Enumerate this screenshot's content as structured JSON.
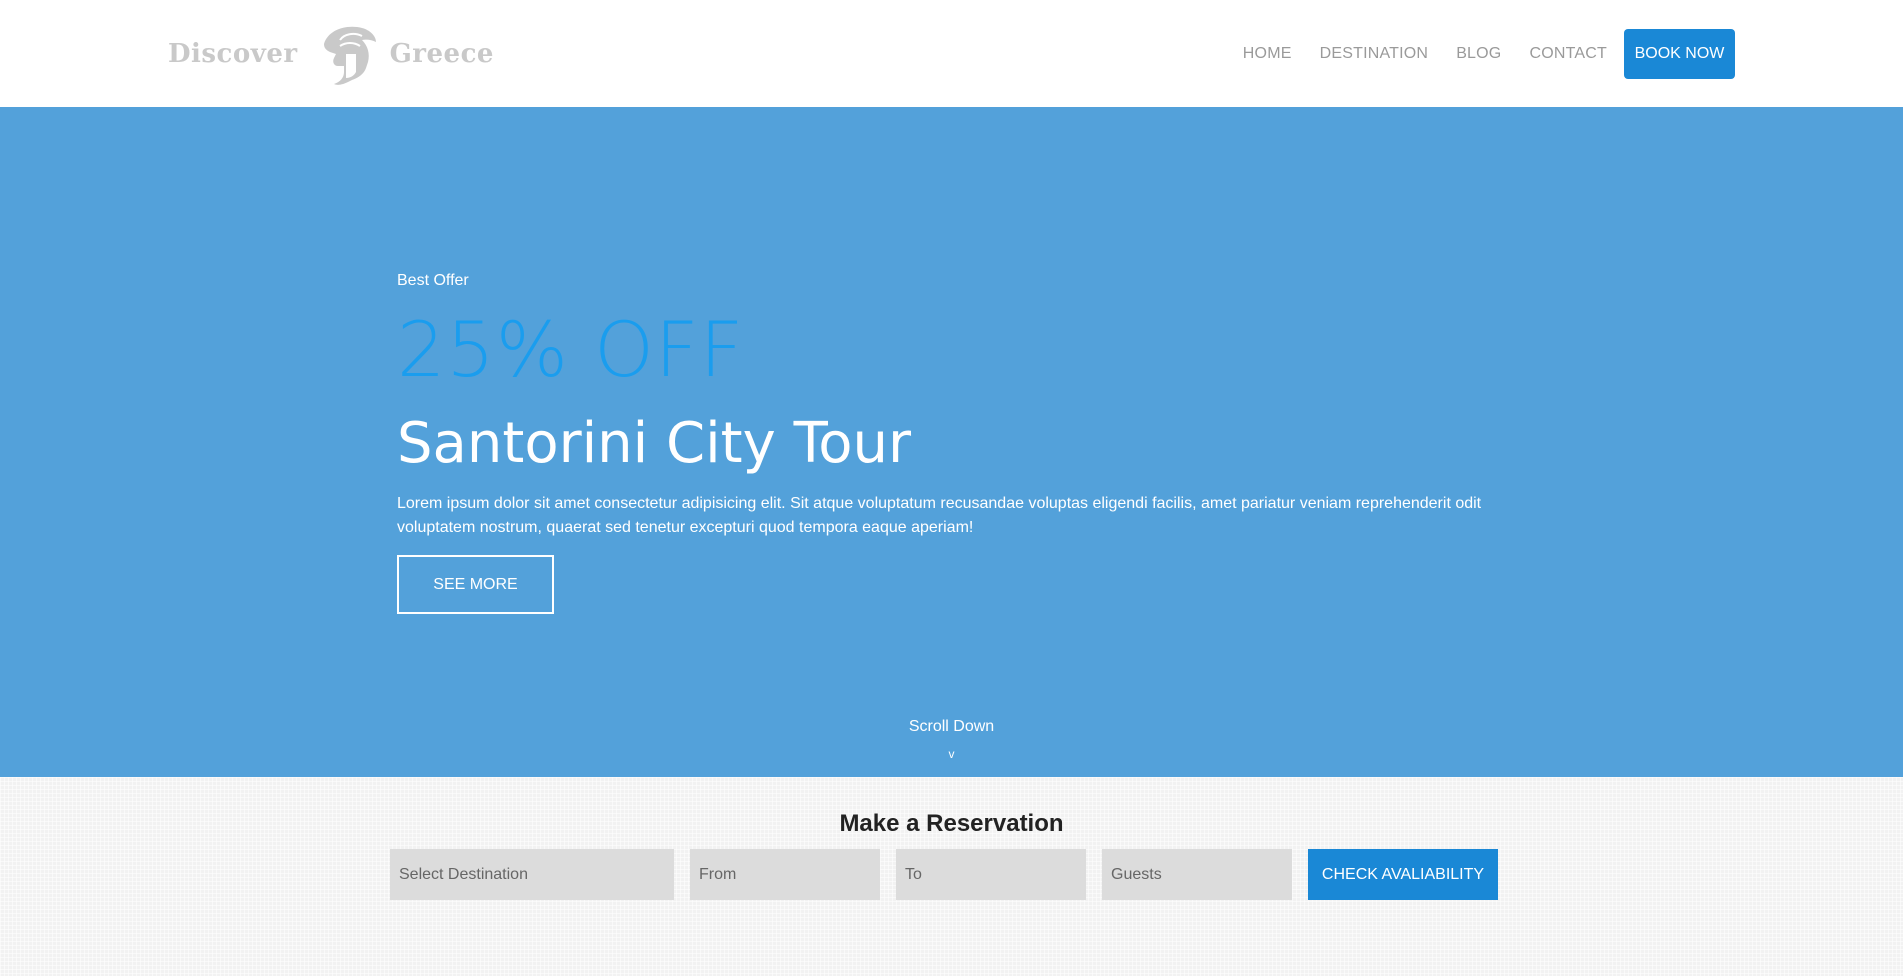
{
  "header": {
    "logo": {
      "word_left": "Discover",
      "word_right": "Greece",
      "icon": "spartan-helmet-icon"
    },
    "nav": {
      "items": [
        {
          "label": "HOME"
        },
        {
          "label": "DESTINATION"
        },
        {
          "label": "BLOG"
        },
        {
          "label": "CONTACT"
        }
      ],
      "book_label": "BOOK NOW"
    }
  },
  "hero": {
    "eyebrow": "Best Offer",
    "discount": "25% OFF",
    "title": "Santorini City Tour",
    "description": "Lorem ipsum dolor sit amet consectetur adipisicing elit. Sit atque voluptatum recusandae voluptas eligendi facilis, amet pariatur veniam reprehenderit odit voluptatem nostrum, quaerat sed tenetur excepturi quod tempora eaque aperiam!",
    "cta_label": "SEE MORE",
    "scroll_label": "Scroll Down",
    "scroll_glyph": "v"
  },
  "reservation": {
    "title": "Make a Reservation",
    "fields": {
      "destination_placeholder": "Select Destination",
      "from_placeholder": "From",
      "to_placeholder": "To",
      "guests_placeholder": "Guests"
    },
    "submit_label": "CHECK AVALIABILITY"
  },
  "colors": {
    "accent": "#1a88d6",
    "hero_bg": "#53a1da",
    "discount": "#1a9dee",
    "logo_gray": "#c9c9c9",
    "nav_gray": "#9a9a9a",
    "field_bg": "#dcdcdc"
  }
}
